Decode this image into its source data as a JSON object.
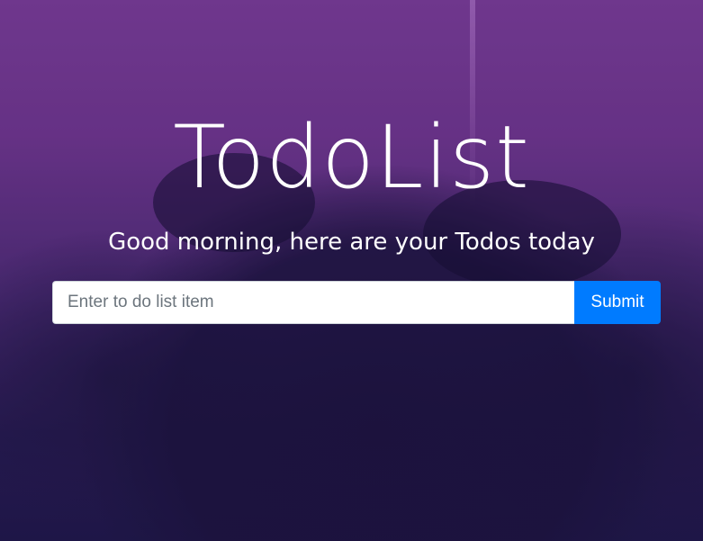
{
  "header": {
    "title": "TodoList",
    "subtitle": "Good morning, here are your Todos today"
  },
  "form": {
    "input_placeholder": "Enter to do list item",
    "input_value": "",
    "submit_label": "Submit"
  },
  "colors": {
    "accent": "#007bff",
    "text": "#ffffff",
    "background_tint": "#7f3f99"
  }
}
